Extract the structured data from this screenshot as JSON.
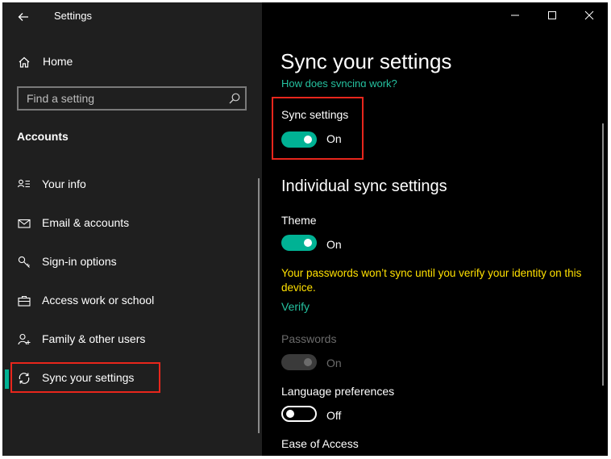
{
  "window": {
    "app_title": "Settings",
    "controls": [
      "minimize",
      "maximize",
      "close"
    ]
  },
  "sidebar": {
    "home_label": "Home",
    "search_placeholder": "Find a setting",
    "section_title": "Accounts",
    "items": [
      {
        "label": "Your info",
        "icon": "person-list-icon"
      },
      {
        "label": "Email & accounts",
        "icon": "mail-icon"
      },
      {
        "label": "Sign-in options",
        "icon": "key-icon"
      },
      {
        "label": "Access work or school",
        "icon": "briefcase-icon"
      },
      {
        "label": "Family & other users",
        "icon": "person-add-icon"
      },
      {
        "label": "Sync your settings",
        "icon": "sync-icon",
        "selected": true
      }
    ]
  },
  "main": {
    "title": "Sync your settings",
    "help_link": "How does syncing work?",
    "sync_settings": {
      "label": "Sync settings",
      "state": "On",
      "on": true
    },
    "individual_heading": "Individual sync settings",
    "theme": {
      "label": "Theme",
      "state": "On",
      "on": true
    },
    "warning": "Your passwords won’t sync until you verify your identity on this device.",
    "verify_link": "Verify",
    "passwords": {
      "label": "Passwords",
      "state": "On",
      "on": true,
      "disabled": true
    },
    "language": {
      "label": "Language preferences",
      "state": "Off",
      "on": false
    },
    "ease_of_access": {
      "label": "Ease of Access"
    }
  },
  "colors": {
    "accent": "#00b294",
    "link": "#25c2a0",
    "warning": "#ffe000",
    "highlight_box": "#e8261c",
    "sidebar_bg": "#1f1f1f",
    "main_bg": "#000000"
  }
}
